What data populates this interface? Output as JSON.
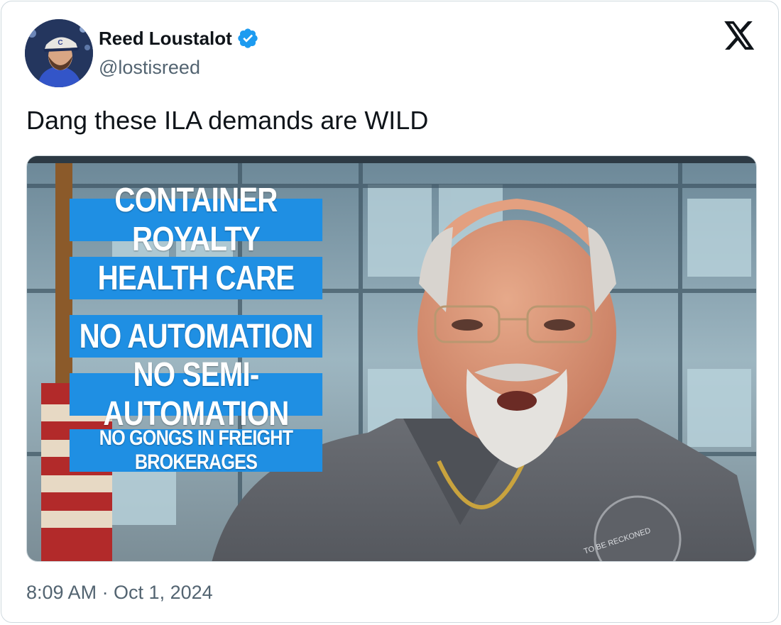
{
  "tweet": {
    "author": {
      "display_name": "Reed Loustalot",
      "handle": "@lostisreed",
      "verified": true,
      "avatar_icon": "profile-photo"
    },
    "brand_icon": "x-logo-icon",
    "text": "Dang these ILA demands are WILD",
    "media": {
      "banners": [
        "CONTAINER ROYALTY",
        "HEALTH CARE",
        "NO AUTOMATION",
        "NO SEMI-AUTOMATION",
        "NO GONGS IN FREIGHT BROKERAGES"
      ],
      "shirt_emblem_text": "TO BE RECKONED"
    },
    "timestamp": "8:09 AM · Oct 1, 2024"
  },
  "colors": {
    "verified_blue": "#1d9bf0",
    "banner_blue": "#1f8fe3",
    "secondary_text": "#536471",
    "primary_text": "#0f1419",
    "card_border": "#cfd9de"
  }
}
